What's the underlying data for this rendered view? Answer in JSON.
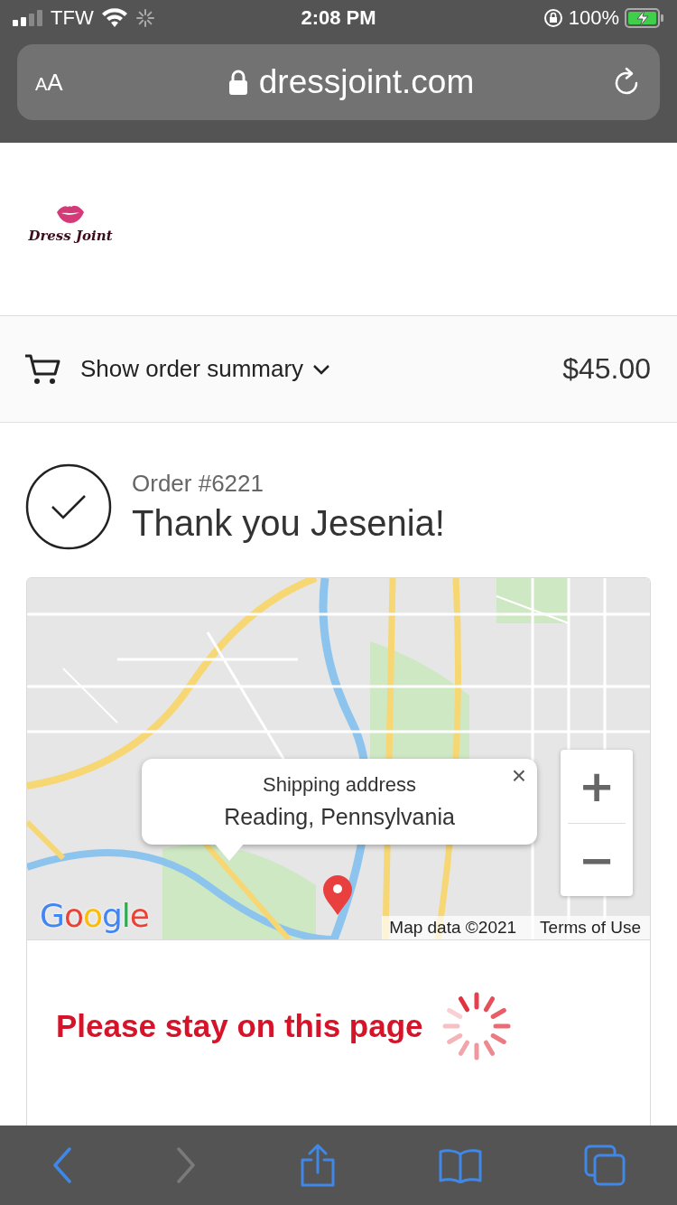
{
  "status_bar": {
    "carrier": "TFW",
    "time": "2:08 PM",
    "battery": "100%"
  },
  "address_bar": {
    "text_size": "AA",
    "url": "dressjoint.com"
  },
  "store": {
    "name": "Dress Joint"
  },
  "order_summary": {
    "label": "Show order summary",
    "expanded": false,
    "total": "$45.00"
  },
  "order": {
    "number": "Order #6221",
    "greeting": "Thank you Jesenia!",
    "confirmed": true
  },
  "map": {
    "popup": {
      "title": "Shipping address",
      "address": "Reading, Pennsylvania",
      "close": "×"
    },
    "zoom_in": "+",
    "zoom_out": "−",
    "logo": "Google",
    "attribution": "Map data ©2021",
    "terms": "Terms of Use"
  },
  "notice": {
    "text": "Please stay on this page",
    "loading": true
  },
  "toolbar": {
    "back": {
      "disabled": false
    },
    "forward": {
      "disabled": true
    }
  }
}
